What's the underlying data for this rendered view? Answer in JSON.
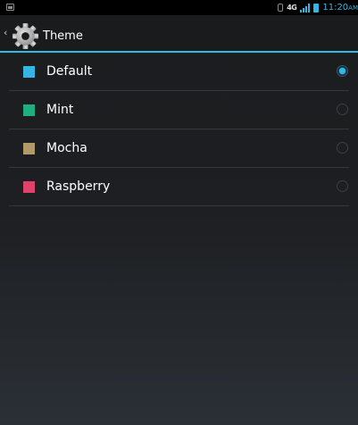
{
  "status_bar": {
    "network": "4G",
    "time": "11:20",
    "ampm": "AM",
    "accent_color": "#34b5e5"
  },
  "action_bar": {
    "title": "Theme",
    "icon": "gear-icon",
    "up_icon": "chevron-left-icon"
  },
  "themes": [
    {
      "label": "Default",
      "color": "#34b5e5",
      "selected": true
    },
    {
      "label": "Mint",
      "color": "#1fae7e",
      "selected": false
    },
    {
      "label": "Mocha",
      "color": "#b19a6a",
      "selected": false
    },
    {
      "label": "Raspberry",
      "color": "#e0426a",
      "selected": false
    }
  ]
}
